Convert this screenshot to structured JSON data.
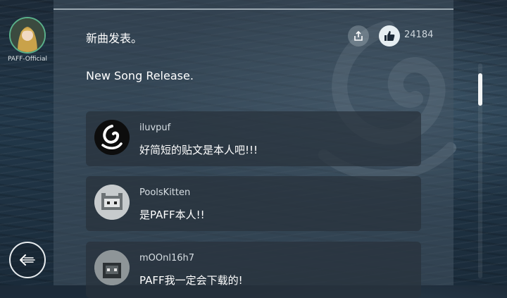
{
  "profile": {
    "name": "PAFF-Official"
  },
  "post": {
    "title": "新曲发表。",
    "body": "New Song Release.",
    "like_count": "24184"
  },
  "comments": [
    {
      "user": "iluvpuf",
      "text": "好简短的贴文是本人吧!!!"
    },
    {
      "user": "PoolsKitten",
      "text": "是PAFF本人!!"
    },
    {
      "user": "mOOnl16h7",
      "text": "PAFF我一定会下载的!"
    }
  ],
  "icons": {
    "share": "share-icon",
    "like": "thumbs-up-icon",
    "back": "back-arrow-icon"
  },
  "colors": {
    "like_bg": "#e6eef2",
    "avatar_ring": "#5ab08a"
  }
}
